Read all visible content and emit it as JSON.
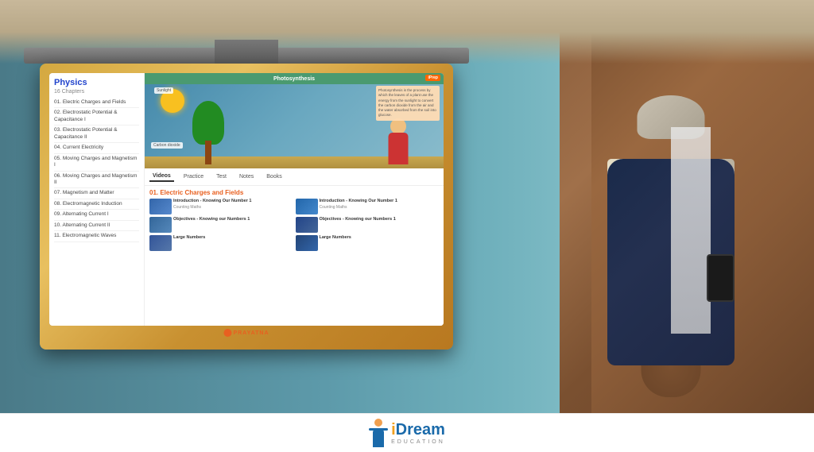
{
  "page": {
    "title": "iDream Education Screenshot"
  },
  "background": {
    "wall_color": "#5d9aaa",
    "door_color": "#7a5030"
  },
  "tv": {
    "brand": "PRAYATNA",
    "frame_color": "#d4a840"
  },
  "app": {
    "subject": "Physics",
    "chapters_count": "16 Chapters",
    "chapters": [
      {
        "num": "01.",
        "title": "Electric Charges and Fields",
        "active": false
      },
      {
        "num": "02.",
        "title": "Electrostatic Potential & Capacitance I",
        "active": false
      },
      {
        "num": "03.",
        "title": "Electrostatic Potential & Capacitance II",
        "active": false
      },
      {
        "num": "04.",
        "title": "Current Electricity",
        "active": false
      },
      {
        "num": "05.",
        "title": "Moving Charges and Magnetism I",
        "active": false
      },
      {
        "num": "06.",
        "title": "Moving Charges and Magnetism II",
        "active": false
      },
      {
        "num": "07.",
        "title": "Magnetism and Matter",
        "active": false
      },
      {
        "num": "08.",
        "title": "Electromagnetic Induction",
        "active": false
      },
      {
        "num": "09.",
        "title": "Alternating Current I",
        "active": false
      },
      {
        "num": "10.",
        "title": "Alternating Current II",
        "active": false
      },
      {
        "num": "11.",
        "title": "Electromagnetic Waves",
        "active": false
      }
    ],
    "content_title": "Photosynthesis",
    "tabs": [
      "Videos",
      "Practice",
      "Test",
      "Notes",
      "Books"
    ],
    "active_tab": "Videos",
    "section_header": "01. Electric Charges and Fields",
    "iprep_label": "iPrep",
    "sunlight_label": "Sunlight",
    "co2_label": "Carbon dioxide",
    "desc_text": "Photosynthesis is the process by which the leaves of a plant use the energy from the sunlight to convert the carbon dioxide from the air and the water absorbed from the soil into glucose.",
    "videos": [
      {
        "title": "Introduction - Knowing Our Number 1",
        "sub": "Counting Maths"
      },
      {
        "title": "Introduction - Knowing Our Number 1",
        "sub": "Counting Maths"
      },
      {
        "title": "Objectives - Knowing our Numbers 1",
        "sub": ""
      },
      {
        "title": "Objectives - Knowing our Numbers 1",
        "sub": ""
      },
      {
        "title": "Large Numbers",
        "sub": ""
      },
      {
        "title": "Large Numbers",
        "sub": ""
      }
    ]
  },
  "logo": {
    "i_text": "i",
    "dream_text": "Dream",
    "full_text": "iDream",
    "subtitle": "EDUCATION",
    "i_color": "#f0a020",
    "dream_color": "#1a6aaa"
  }
}
